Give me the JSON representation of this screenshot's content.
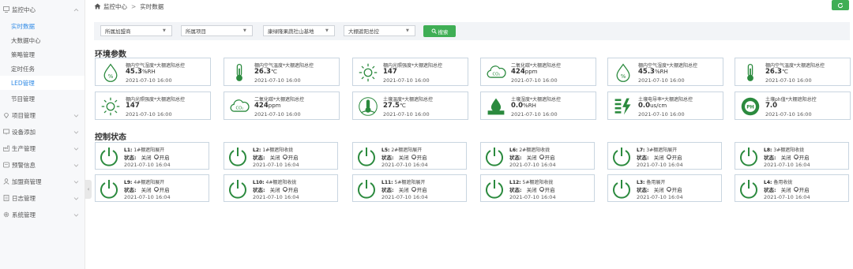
{
  "sidebar": {
    "sections": [
      {
        "label": "监控中心",
        "icon": "monitor-icon",
        "expanded": true
      },
      {
        "label": "项目管理",
        "icon": "location-pin-icon"
      },
      {
        "label": "设备添加",
        "icon": "device-icon"
      },
      {
        "label": "生产管理",
        "icon": "production-icon"
      },
      {
        "label": "预警信息",
        "icon": "alert-icon"
      },
      {
        "label": "加盟商管理",
        "icon": "user-icon"
      },
      {
        "label": "日志管理",
        "icon": "log-icon"
      },
      {
        "label": "系统管理",
        "icon": "gear-icon"
      }
    ],
    "subitems": [
      {
        "label": "实时数据",
        "state": "active"
      },
      {
        "label": "大数据中心"
      },
      {
        "label": "策略管理"
      },
      {
        "label": "定时任务"
      },
      {
        "label": "LED管理",
        "state": "highlight"
      },
      {
        "label": "节目管理"
      }
    ]
  },
  "breadcrumb": {
    "home": "监控中心",
    "separator": ">",
    "current": "实时数据"
  },
  "filters": {
    "franchisee": "所属加盟商",
    "project": "所属项目",
    "site": "康绿隆果蔬社山基地",
    "greenhouse": "大棚遮阳总控",
    "search": "搜索"
  },
  "env_section_title": "环境参数",
  "env_cards": [
    {
      "label": "棚内空气湿度*大棚遮阳总控",
      "value": "45.3",
      "unit": "%RH",
      "time": "2021-07-10 16:00",
      "icon": "humidity-drop-icon"
    },
    {
      "label": "棚内空气温度*大棚遮阳总控",
      "value": "26.3",
      "unit": "℃",
      "time": "2021-07-10 16:00",
      "icon": "thermometer-icon"
    },
    {
      "label": "棚内光照强度*大棚遮阳总控",
      "value": "147",
      "unit": "",
      "time": "2021-07-10 16:00",
      "icon": "sun-icon"
    },
    {
      "label": "二氧化碳*大棚遮阳总控",
      "value": "424",
      "unit": "ppm",
      "time": "2021-07-10 16:00",
      "icon": "co2-cloud-icon"
    },
    {
      "label": "棚内空气湿度*大棚遮阳总控",
      "value": "45.3",
      "unit": "%RH",
      "time": "2021-07-10 16:00",
      "icon": "humidity-drop-icon"
    },
    {
      "label": "棚内空气温度*大棚遮阳总控",
      "value": "26.3",
      "unit": "℃",
      "time": "2021-07-10 16:00",
      "icon": "thermometer-icon"
    },
    {
      "label": "棚内光照强度*大棚遮阳总控",
      "value": "147",
      "unit": "",
      "time": "2021-07-10 16:00",
      "icon": "sun-icon"
    },
    {
      "label": "二氧化碳*大棚遮阳总控",
      "value": "424",
      "unit": "ppm",
      "time": "2021-07-10 16:00",
      "icon": "co2-cloud-icon"
    },
    {
      "label": "土壤温度*大棚遮阳总控",
      "value": "27.5",
      "unit": "℃",
      "time": "2021-07-10 16:00",
      "icon": "soil-temperature-icon"
    },
    {
      "label": "土壤湿度*大棚遮阳总控",
      "value": "0.0",
      "unit": "%RH",
      "time": "2021-07-10 16:00",
      "icon": "soil-moisture-icon"
    },
    {
      "label": "土壤电导率*大棚遮阳总控",
      "value": "0.0",
      "unit": "us/cm",
      "time": "2021-07-10 16:00",
      "icon": "conductivity-icon"
    },
    {
      "label": "土壤ph值*大棚遮阳总控",
      "value": "7.0",
      "unit": "",
      "time": "2021-07-10 16:00",
      "icon": "ph-icon"
    }
  ],
  "control_section_title": "控制状态",
  "control_state_label": "状态:",
  "control_off_label": "关闭",
  "control_on_label": "开启",
  "control_cards": [
    {
      "code": "L1:",
      "name": "1#棚遮阳展开",
      "time": "2021-07-10 16:04"
    },
    {
      "code": "L2:",
      "name": "1#棚遮阳收拢",
      "time": "2021-07-10 16:04"
    },
    {
      "code": "L5:",
      "name": "2#棚遮阳展开",
      "time": "2021-07-10 16:04"
    },
    {
      "code": "L6:",
      "name": "2#棚遮阳收拢",
      "time": "2021-07-10 16:04"
    },
    {
      "code": "L7:",
      "name": "3#棚遮阳展开",
      "time": "2021-07-10 16:04"
    },
    {
      "code": "L8:",
      "name": "3#棚遮阳收拢",
      "time": "2021-07-10 16:04"
    },
    {
      "code": "L9:",
      "name": "4#棚遮阳展开",
      "time": "2021-07-10 16:04"
    },
    {
      "code": "L10:",
      "name": "4#棚遮阳收拢",
      "time": "2021-07-10 16:04"
    },
    {
      "code": "L11:",
      "name": "5#棚遮阳展开",
      "time": "2021-07-10 16:04"
    },
    {
      "code": "L12:",
      "name": "5#棚遮阳收拢",
      "time": "2021-07-10 16:04"
    },
    {
      "code": "L3:",
      "name": "备用展开",
      "time": "2021-07-10 16:04"
    },
    {
      "code": "L4:",
      "name": "备用收拢",
      "time": "2021-07-10 16:04"
    }
  ],
  "colors": {
    "accent": "#3fae55",
    "link": "#2f8ae6",
    "icon": "#2b8a3e",
    "card_border": "#c9d5e0"
  }
}
